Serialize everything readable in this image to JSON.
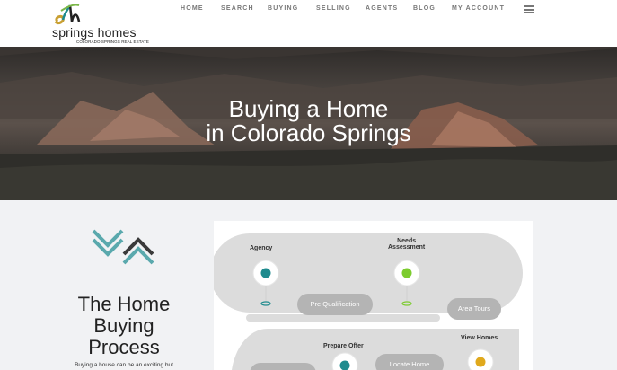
{
  "header": {
    "logo_text": "springs homes",
    "logo_sub": "COLORADO SPRINGS REAL ESTATE",
    "nav": [
      "HOME",
      "SEARCH",
      "BUYING",
      "SELLING",
      "AGENTS",
      "BLOG",
      "MY ACCOUNT"
    ],
    "menu_icon": "hamburger-icon"
  },
  "hero": {
    "title_line1": "Buying a Home",
    "title_line2": "in Colorado Springs"
  },
  "section": {
    "title_line1": "The Home",
    "title_line2": "Buying",
    "title_line3": "Process",
    "intro": "Buying a house can be an exciting but"
  },
  "diagram": {
    "steps": {
      "agency": "Agency",
      "needs_1": "Needs",
      "needs_2": "Assessment",
      "prepare_offer": "Prepare Offer",
      "view_homes": "View Homes"
    },
    "pills": {
      "pre_qualification": "Pre Qualification",
      "area_tours": "Area Tours",
      "locate_home": "Locate Home"
    },
    "colors": {
      "teal": "#1f8b8e",
      "green": "#7ccc2e",
      "gold": "#e0a91d",
      "road": "#dcdcdc"
    }
  },
  "colors": {
    "teal_accent": "#5aa9ad",
    "dark_accent": "#3a3a3a"
  }
}
